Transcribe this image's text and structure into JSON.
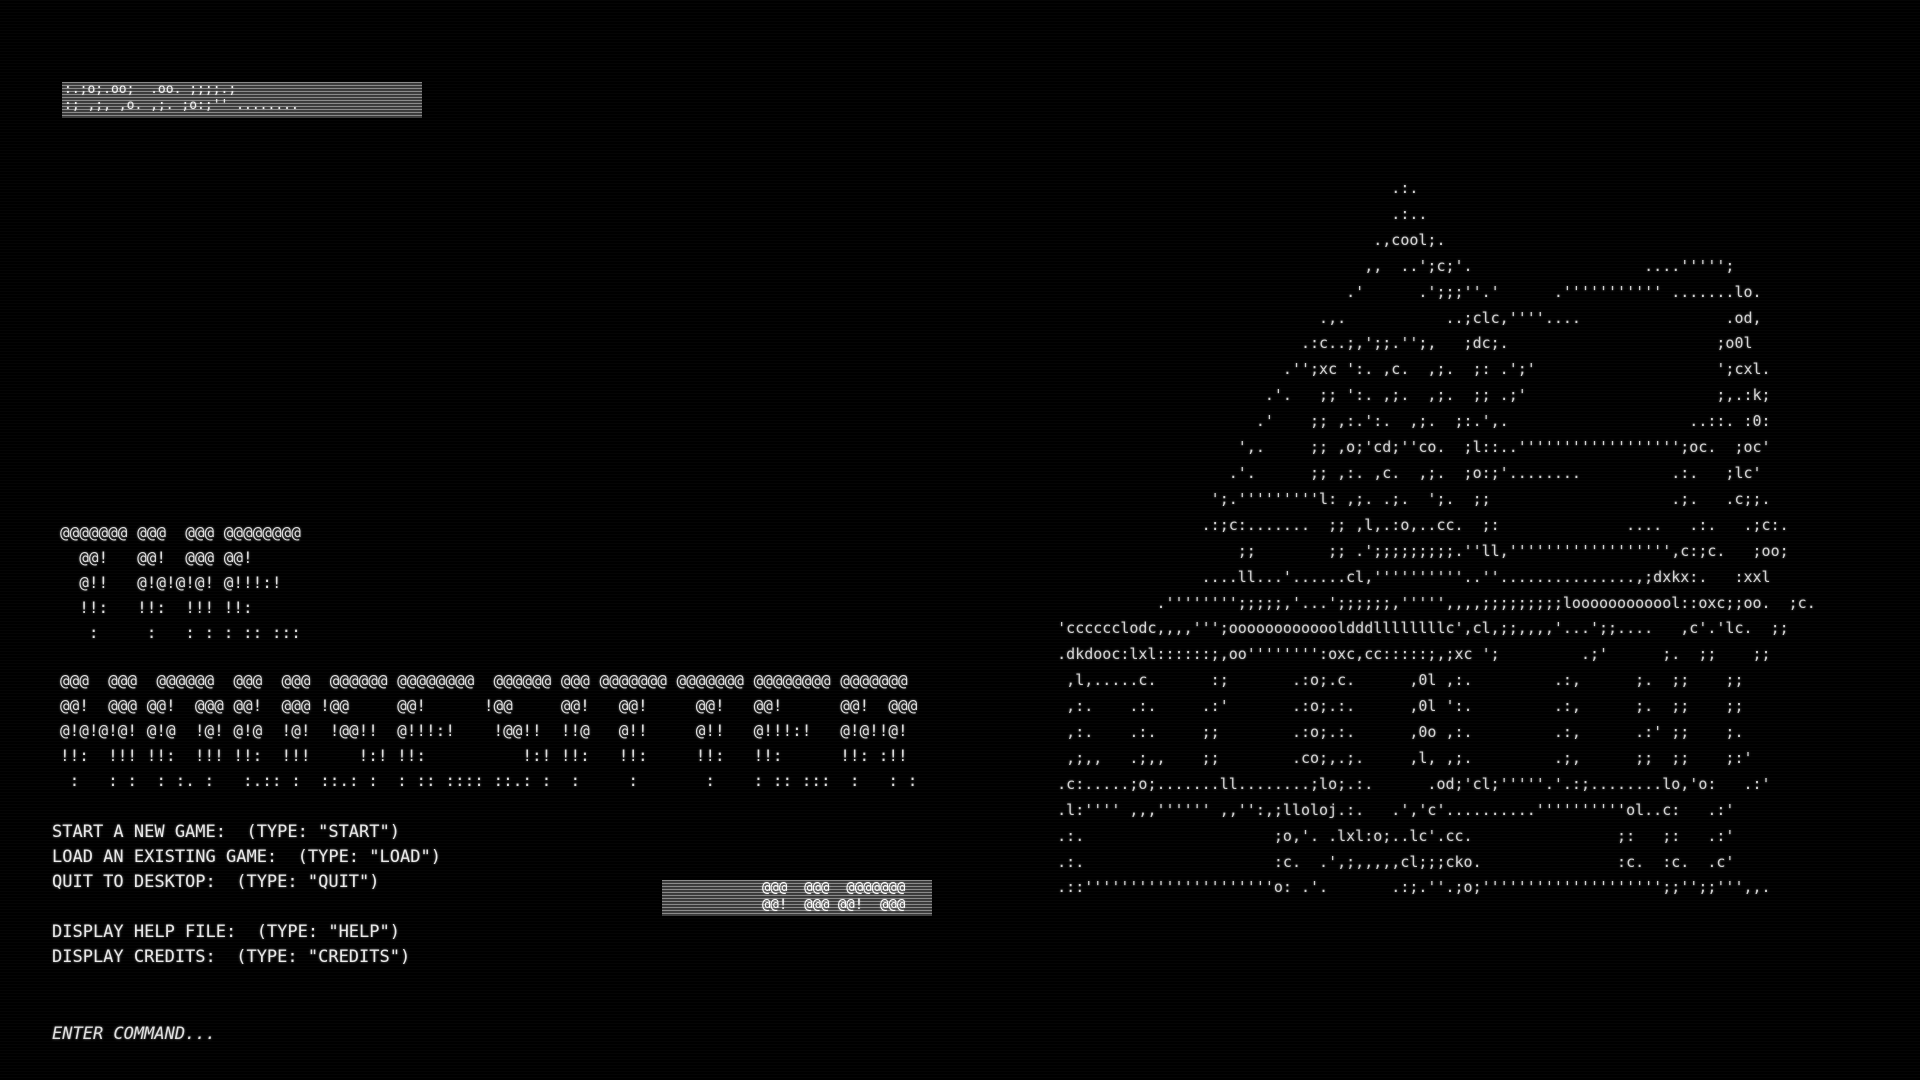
{
  "screen": {
    "background": "#000000",
    "text_color": "#e2e2e2"
  },
  "glitch_top": {
    "lines": [
      ":.;o;.oo;  .oo. ;;;;.;",
      ":; ,;, ,o. ,;. ;o:;'' ........"
    ]
  },
  "logo_small": {
    "lines": [
      "@@@@@@@ @@@  @@@ @@@@@@@@",
      "  @@!   @@!  @@@ @@!",
      "  @!!   @!@!@!@! @!!!:!",
      "  !!:   !!:  !!! !!:",
      "   :     :   : : : :: :::"
    ]
  },
  "logo_big": {
    "lines": [
      "@@@  @@@  @@@@@@  @@@  @@@  @@@@@@ @@@@@@@@  @@@@@@ @@@ @@@@@@@ @@@@@@@ @@@@@@@@ @@@@@@@",
      "@@!  @@@ @@!  @@@ @@!  @@@ !@@     @@!      !@@     @@!   @@!     @@!   @@!      @@!  @@@",
      "@!@!@!@! @!@  !@! @!@  !@!  !@@!!  @!!!:!    !@@!!  !!@   @!!     @!!   @!!!:!   @!@!!@!",
      "!!:  !!! !!:  !!! !!:  !!!     !:! !!:          !:! !!:   !!:     !!:   !!:      !!: :!!",
      " :   : :  : :. :   :.:: :  ::.: :  : :: :::: ::.: :  :     :       :    : :: :::  :   : :"
    ]
  },
  "glitch_mid": {
    "lines": [
      "@@@  @@@  @@@@@@@",
      "@@!  @@@ @@!  @@@"
    ]
  },
  "menu": {
    "start": "START A NEW GAME:  (TYPE: \"START\")",
    "load": "LOAD AN EXISTING GAME:  (TYPE: \"LOAD\")",
    "quit": "QUIT TO DESKTOP:  (TYPE: \"QUIT\")",
    "help": "DISPLAY HELP FILE:  (TYPE: \"HELP\")",
    "credits": "DISPLAY CREDITS:  (TYPE: \"CREDITS\")"
  },
  "prompt": {
    "text": "ENTER COMMAND..."
  },
  "house_art": {
    "lines": [
      "                                          .:.",
      "                                          .:..",
      "                                        .,cool;.",
      "                                       ,,  ..';c;'.                   ....''''';",
      "                                     .'      .';;;''.'      .''''''''''' .......lo.",
      "                                  .,.           ..;clc,''''....                .od,",
      "                                .:c..;,';;.'';,   ;dc;.                       ;o0l",
      "                              .'';xc ':. ,c.  ,;.  ;: .';'                    ';cxl.",
      "                            .'.   ;; ':. ,;.  ,;.  ;; .;'                     ;,.:k;",
      "                           .'    ;; ,:.':.  ,;.  ;:.',.                    ..::. :0:",
      "                         ',.     ;; ,o;'cd;''co.  ;l::..'''''''''''''''''';oc.  ;oc'",
      "                        .'.      ;; ,:. ,c.  ,;.  ;o:;'........          .:.   ;lc'",
      "                      ';.'''''''''l: ,;. .;.  ';.  ;;                    .;.   .c;;.",
      "                     .:;c:.......  ;; ,l,.:o,..cc.  ;:              ....   .:.   .;c:.",
      "                         ;;        ;; .';;;;;;;;;.''ll,'''''''''''''''''',c:;c.   ;oo;",
      "                     ....ll...'......cl,''''''''''..''...............,;dxkx:.   :xxl",
      "                .'''''''';;;;;,'...';;;;;;,''''',,,,;;;;;;;;;loooooooooool::oxc;;oo.  ;c.",
      "     'cccccclodc,,,,''';ooooooooooooldddllllllllc',cl,;;,,,,'...';;....   ,c'.'lc.  ;;",
      "     .dkdooc:lxl::::::;,oo'''''''':oxc,cc:::::;,;xc ';         .;'      ;.  ;;    ;;",
      "      ,l,.....c.      :;       .:o;.c.      ,0l ,:.         .:,      ;.  ;;    ;;",
      "      ,:.    .:.     .:'       .:o;.:.      ,0l ':.         .:,      ;.  ;;    ;;",
      "      ,:.    .:.     ;;        .:o;.:.      ,0o ,:.         .:,      .:' ;;    ;.",
      "      ,;,,   .;,,    ;;        .co;,.;.     ,l, ,;.         .;,      ;;  ;;    ;:'",
      "     .c:.....;o;.......ll........;lo;.:.      .od;'cl;'''''.'.:;........lo,'o:   .:'",
      "     .l:'''' ,,,'''''' ,,'':,;lloloj.:.   .','c'..........''''''''''ol..c:   .:'",
      "     .:.                     ;o,'. .lxl:o;..lc'.cc.                ;:   ;:   .:'",
      "     .:.                     :c.  .',;,,,,,cl;;;cko.               :c.  :c.  .c'",
      "     .::'''''''''''''''''''''o: .'.       .:;.''.;o;'''''''''''''''''''';;'';;''',,."
    ]
  }
}
